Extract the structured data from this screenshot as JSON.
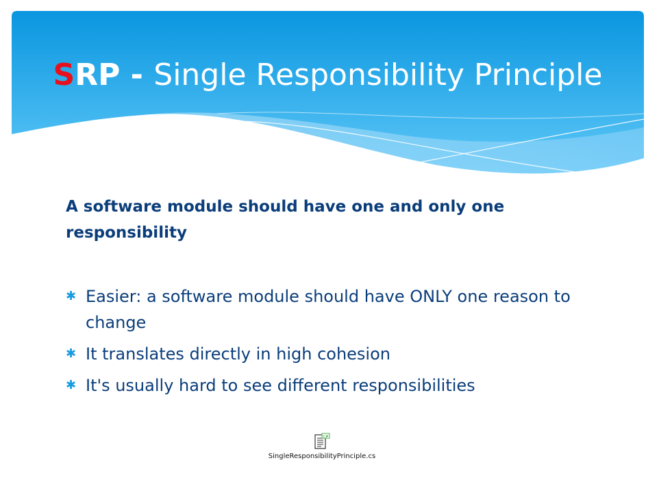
{
  "title": {
    "abbr_first": "S",
    "abbr_rest": "RP",
    "separator": " - ",
    "text": "Single Responsibility Principle"
  },
  "subtitle": "A software module should have one and only one responsibility",
  "bullets": [
    "Easier: a software module should have ONLY one reason to change",
    "It translates directly in high cohesion",
    "It's usually hard to see different responsibilities"
  ],
  "bullet_icon": "asterisk-bullet-icon",
  "attachment": {
    "filename": "SingleResponsibilityPrinciple.cs",
    "icon": "cs-file-icon"
  },
  "colors": {
    "header_top": "#0a96e0",
    "header_bottom": "#58c4f6",
    "title_text": "#ffffff",
    "accent_red": "#e8101c",
    "body_text": "#0a3d7a",
    "bullet": "#1a9be0"
  }
}
